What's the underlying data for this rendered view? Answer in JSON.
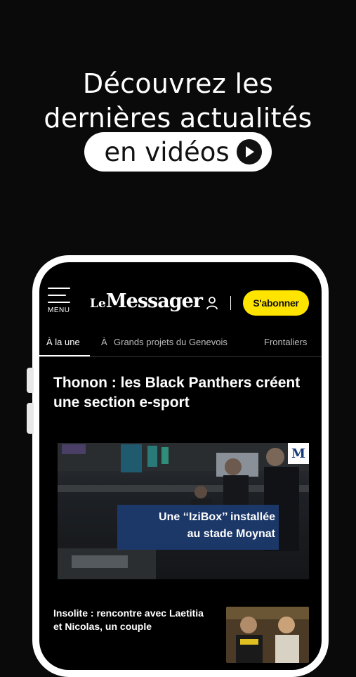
{
  "promo": {
    "line1": "Découvrez les",
    "line2": "dernières actualités",
    "pill_text": "en vidéos",
    "pill_icon": "play-icon"
  },
  "app": {
    "menu_label": "MENU",
    "logo_le": "Le",
    "logo_name": "Messager",
    "account_icon": "user-icon",
    "subscribe_label": "S'abonner",
    "accent_color": "#ffe400"
  },
  "tabs": [
    {
      "label": "À la une",
      "active": true
    },
    {
      "label": "À",
      "active": false
    },
    {
      "label": "Grands projets du Genevois",
      "active": false
    },
    {
      "label": "Frontaliers",
      "active": false
    }
  ],
  "article": {
    "title": "Thonon : les Black Panthers créent une section e-sport",
    "hero_caption_line1": "Une ‘‘IziBox’’ installée",
    "hero_caption_line2": "au stade Moynat",
    "hero_badge": "M"
  },
  "news_list": [
    {
      "title": "Insolite : rencontre avec Laetitia et Nicolas, un couple"
    }
  ]
}
